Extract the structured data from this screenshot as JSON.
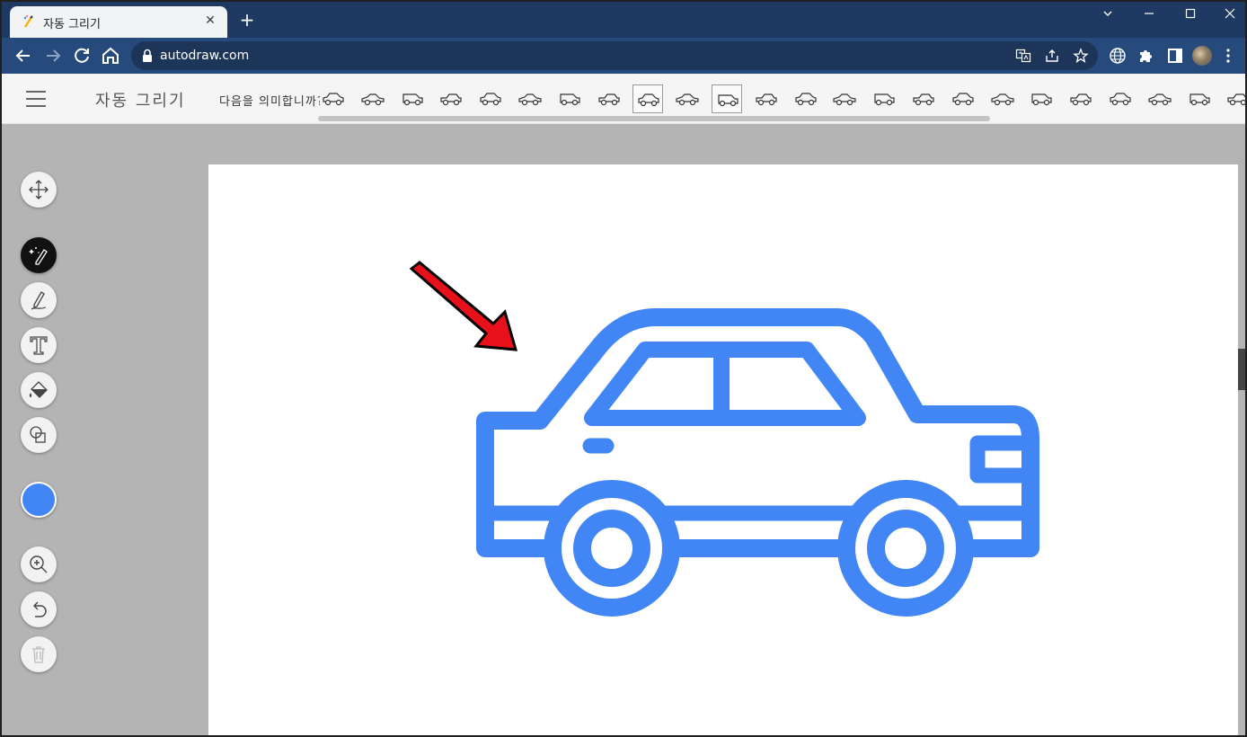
{
  "browser": {
    "tab_title": "자동 그리기",
    "url": "autodraw.com",
    "tab_close_glyph": "✕",
    "newtab_glyph": "+"
  },
  "app": {
    "title": "자동 그리기",
    "suggestion_label": "다음을 의미합니까?"
  },
  "suggestions": [
    {
      "name": "suv-front-icon",
      "selected": false
    },
    {
      "name": "sports-car-icon",
      "selected": false
    },
    {
      "name": "car-top-icon",
      "selected": false
    },
    {
      "name": "race-car-top-icon",
      "selected": false
    },
    {
      "name": "pickup-icon",
      "selected": false
    },
    {
      "name": "low-car-icon",
      "selected": false
    },
    {
      "name": "compact-car-icon",
      "selected": false
    },
    {
      "name": "coupe-icon",
      "selected": false
    },
    {
      "name": "sedan-icon",
      "selected": true
    },
    {
      "name": "car-front-icon",
      "selected": false
    },
    {
      "name": "hatchback-icon",
      "selected": true
    },
    {
      "name": "bus-icon",
      "selected": false
    },
    {
      "name": "tram-icon",
      "selected": false
    },
    {
      "name": "fire-truck-icon",
      "selected": false
    },
    {
      "name": "long-truck-icon",
      "selected": false
    },
    {
      "name": "tow-truck-icon",
      "selected": false
    },
    {
      "name": "semi-truck-front-icon",
      "selected": false
    },
    {
      "name": "pickup-side-icon",
      "selected": false
    },
    {
      "name": "van-front-icon",
      "selected": false
    },
    {
      "name": "limo-icon",
      "selected": false
    },
    {
      "name": "tractor-icon",
      "selected": false
    },
    {
      "name": "tractor-2-icon",
      "selected": false
    },
    {
      "name": "tractor-3-icon",
      "selected": false
    },
    {
      "name": "wagon-icon",
      "selected": false
    }
  ],
  "tools": [
    {
      "name": "move-tool",
      "icon": "move-icon",
      "active": false
    },
    {
      "name": "autodraw-tool",
      "icon": "magic-pencil-icon",
      "active": true
    },
    {
      "name": "draw-tool",
      "icon": "pencil-icon",
      "active": false
    },
    {
      "name": "type-tool",
      "icon": "text-icon",
      "active": false
    },
    {
      "name": "fill-tool",
      "icon": "paint-bucket-icon",
      "active": false
    },
    {
      "name": "shape-tool",
      "icon": "shapes-icon",
      "active": false
    },
    {
      "name": "zoom-tool",
      "icon": "zoom-in-icon",
      "active": false
    },
    {
      "name": "undo-tool",
      "icon": "undo-icon",
      "active": false
    },
    {
      "name": "delete-tool",
      "icon": "trash-icon",
      "active": false
    }
  ],
  "colors": {
    "selected_fill": "#4285f4",
    "arrow": "#e8101a"
  }
}
